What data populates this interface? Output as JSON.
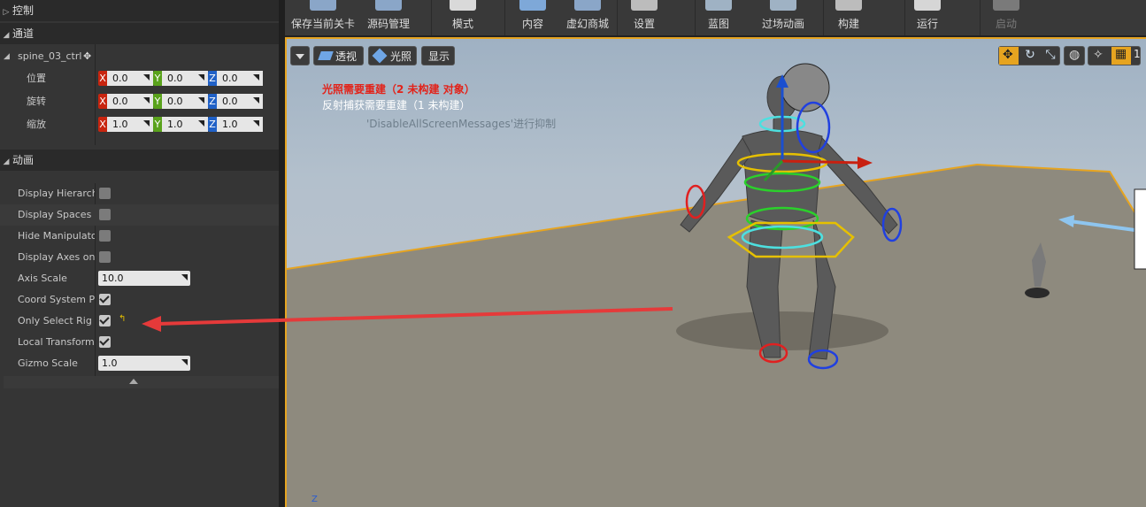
{
  "left_panel": {
    "control_header": "控制",
    "channel_header": "通道",
    "ctrl_name": "spine_03_ctrl",
    "transform": [
      {
        "label": "位置",
        "x": "0.0",
        "y": "0.0",
        "z": "0.0"
      },
      {
        "label": "旋转",
        "x": "0.0",
        "y": "0.0",
        "z": "0.0"
      },
      {
        "label": "缩放",
        "x": "1.0",
        "y": "1.0",
        "z": "1.0"
      }
    ],
    "axis_letters": {
      "x": "X",
      "y": "Y",
      "z": "Z"
    },
    "animation_header": "动画",
    "anim_props": [
      {
        "label": "Display Hierarchy",
        "type": "check",
        "checked": false
      },
      {
        "label": "Display Spaces",
        "type": "check",
        "checked": false
      },
      {
        "label": "Hide Manipulators",
        "type": "check",
        "checked": false
      },
      {
        "label": "Display Axes on Selection",
        "type": "check",
        "checked": false
      },
      {
        "label": "Axis Scale",
        "type": "number",
        "value": "10.0"
      },
      {
        "label": "Coord System Per Widget Mode",
        "type": "check",
        "checked": true
      },
      {
        "label": "Only Select Rig Controls",
        "type": "check",
        "checked": true
      },
      {
        "label": "Local Transforms in Each Local Space",
        "type": "check",
        "checked": true
      },
      {
        "label": "Gizmo Scale",
        "type": "number",
        "value": "1.0"
      }
    ]
  },
  "toolbar": {
    "buttons": [
      {
        "label": "保存当前关卡",
        "icon": "save-icon"
      },
      {
        "label": "源码管理",
        "icon": "source-control-icon"
      },
      {
        "label": "模式",
        "icon": "modes-icon"
      },
      {
        "label": "内容",
        "icon": "content-icon"
      },
      {
        "label": "虚幻商城",
        "icon": "marketplace-icon"
      },
      {
        "label": "设置",
        "icon": "settings-icon"
      },
      {
        "label": "蓝图",
        "icon": "blueprint-icon"
      },
      {
        "label": "过场动画",
        "icon": "cinematics-icon"
      },
      {
        "label": "构建",
        "icon": "build-icon"
      },
      {
        "label": "运行",
        "icon": "play-icon"
      },
      {
        "label": "启动",
        "icon": "launch-icon"
      }
    ]
  },
  "viewport": {
    "perspective_label": "透视",
    "lit_label": "光照",
    "show_label": "显示",
    "messages": {
      "lighting": "光照需要重建（2 未构建 对象）",
      "reflection": "反射捕获需要重建（1 未构建）",
      "suppress": "'DisableAllScreenMessages'进行抑制"
    },
    "grid_value": "1",
    "axis_indicator": "Z"
  },
  "colors": {
    "accent": "#e6a420",
    "axis_x": "#c8250f",
    "axis_y": "#5aa21c",
    "axis_z": "#2061c7",
    "warning": "#e2231a"
  }
}
